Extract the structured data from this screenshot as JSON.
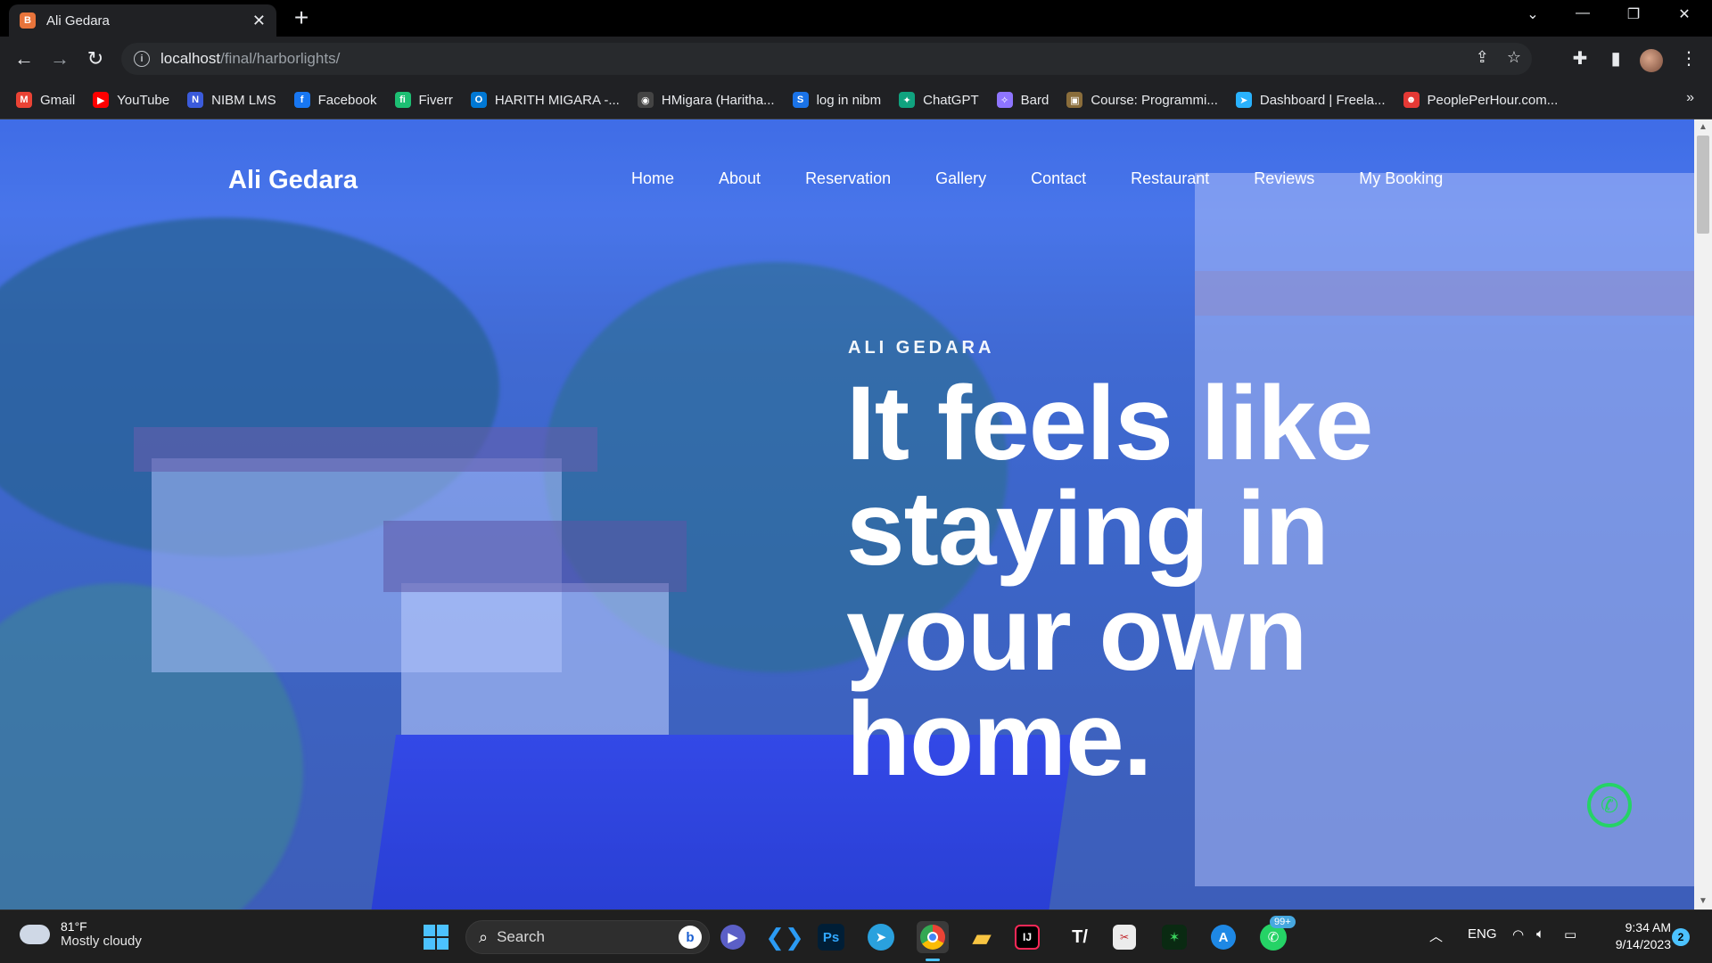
{
  "browser": {
    "tab_title": "Ali Gedara",
    "tab_favicon": "B",
    "new_tab_icon": "+",
    "url_host": "localhost",
    "url_path": "/final/harborlights/",
    "bookmarks": [
      {
        "label": "Gmail",
        "icon": "M",
        "color": "#ea4335"
      },
      {
        "label": "YouTube",
        "icon": "▶",
        "color": "#ff0000"
      },
      {
        "label": "NIBM LMS",
        "icon": "N",
        "color": "#3b5bdb"
      },
      {
        "label": "Facebook",
        "icon": "f",
        "color": "#1877f2"
      },
      {
        "label": "Fiverr",
        "icon": "fi",
        "color": "#1dbf73"
      },
      {
        "label": "HARITH MIGARA -...",
        "icon": "O",
        "color": "#0078d4"
      },
      {
        "label": "HMigara (Haritha...",
        "icon": "◉",
        "color": "#444"
      },
      {
        "label": "log in nibm",
        "icon": "S",
        "color": "#1a73e8"
      },
      {
        "label": "ChatGPT",
        "icon": "✦",
        "color": "#10a37f"
      },
      {
        "label": "Bard",
        "icon": "✧",
        "color": "#8e75ff"
      },
      {
        "label": "Course: Programmi...",
        "icon": "▣",
        "color": "#8a6d3b"
      },
      {
        "label": "Dashboard | Freela...",
        "icon": "➤",
        "color": "#29b2fe"
      },
      {
        "label": "PeoplePerHour.com...",
        "icon": "☻",
        "color": "#e53935"
      }
    ],
    "bookmarks_more": "»"
  },
  "site": {
    "brand": "Ali Gedara",
    "nav": [
      "Home",
      "About",
      "Reservation",
      "Gallery",
      "Contact",
      "Restaurant",
      "Reviews",
      "My Booking"
    ],
    "eyebrow": "ALI GEDARA",
    "headline_lines": [
      "It feels like",
      "staying in",
      "your own",
      "home."
    ],
    "whatsapp_icon": "whatsapp-icon"
  },
  "taskbar": {
    "weather_temp": "81°F",
    "weather_desc": "Mostly cloudy",
    "search_placeholder": "Search",
    "apps": [
      "teams",
      "vscode",
      "photoshop",
      "telegram",
      "chrome",
      "file-explorer",
      "intellij",
      "typora",
      "snipping",
      "gaming",
      "app-store",
      "whatsapp"
    ],
    "whatsapp_badge": "99+",
    "tray_lang": "ENG",
    "time": "9:34 AM",
    "date": "9/14/2023",
    "notifications": "2"
  },
  "colors": {
    "accent_blue": "#4cc2ff",
    "whatsapp_green": "#25d366",
    "hero_tint": "#4a78e4"
  }
}
